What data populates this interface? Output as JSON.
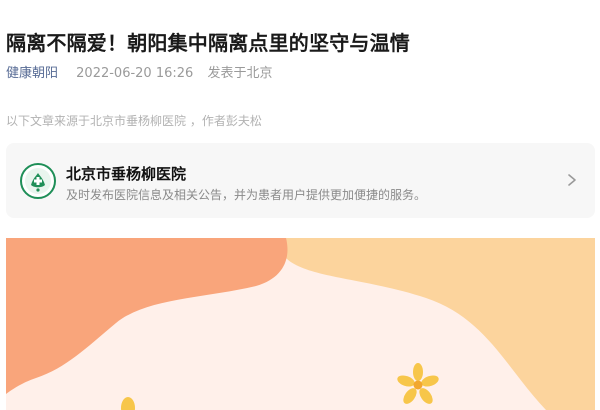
{
  "article": {
    "title": "隔离不隔爱！朝阳集中隔离点里的坚守与温情",
    "account": "健康朝阳",
    "date": "2022-06-20 16:26",
    "location": "发表于北京",
    "source_note": "以下文章来源于北京市垂杨柳医院 ，作者彭夫松"
  },
  "source_card": {
    "name": "北京市垂杨柳医院",
    "description": "及时发布医院信息及相关公告，并为患者用户提供更加便捷的服务。",
    "logo_icon": "hospital-logo-icon",
    "arrow_icon": "chevron-right-icon"
  },
  "colors": {
    "account_link": "#576b95",
    "banner_orange": "#f9a57b",
    "banner_peach": "#fcd49d",
    "banner_cream": "#fff0ea",
    "flower_yellow": "#f7c64a"
  }
}
